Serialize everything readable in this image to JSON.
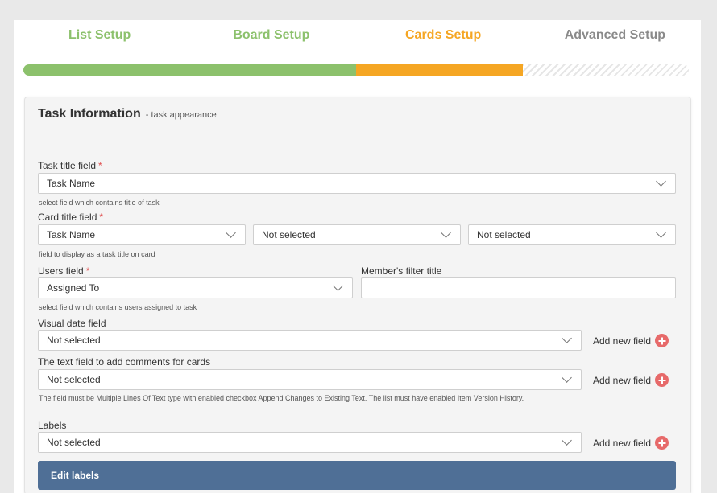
{
  "steps": [
    {
      "label": "List Setup",
      "color": "#8cc16c"
    },
    {
      "label": "Board Setup",
      "color": "#8cc16c"
    },
    {
      "label": "Cards Setup",
      "color": "#f5a623"
    },
    {
      "label": "Advanced Setup",
      "color": "#8a8a8a"
    }
  ],
  "progress": {
    "completed_fraction": 0.5,
    "current_fraction": 0.25,
    "completed_color": "#8cc16c",
    "current_color": "#f5a623"
  },
  "panel": {
    "title": "Task Information",
    "subtitle": "- task appearance"
  },
  "fields": {
    "task_title": {
      "label": "Task title field",
      "required": "*",
      "value": "Task Name",
      "hint": "select field which contains title of task"
    },
    "card_title": {
      "label": "Card title field",
      "required": "*",
      "values": [
        "Task Name",
        "Not selected",
        "Not selected"
      ],
      "hint": "field to display as a task title on card"
    },
    "users": {
      "label": "Users field",
      "required": "*",
      "value": "Assigned To",
      "hint": "select field which contains users assigned to task"
    },
    "member_filter": {
      "label": "Member's filter title",
      "value": ""
    },
    "visual_date": {
      "label": "Visual date field",
      "value": "Not selected",
      "add_new": "Add new field"
    },
    "comments": {
      "label": "The text field to add comments for cards",
      "value": "Not selected",
      "add_new": "Add new field",
      "hint": "The field must be Multiple Lines Of Text type with enabled checkbox Append Changes to Existing Text. The list must have enabled Item Version History."
    },
    "labels": {
      "label": "Labels",
      "value": "Not selected",
      "add_new": "Add new field"
    }
  },
  "edit_labels_button": {
    "label": "Edit labels",
    "color": "#4f6f96"
  }
}
